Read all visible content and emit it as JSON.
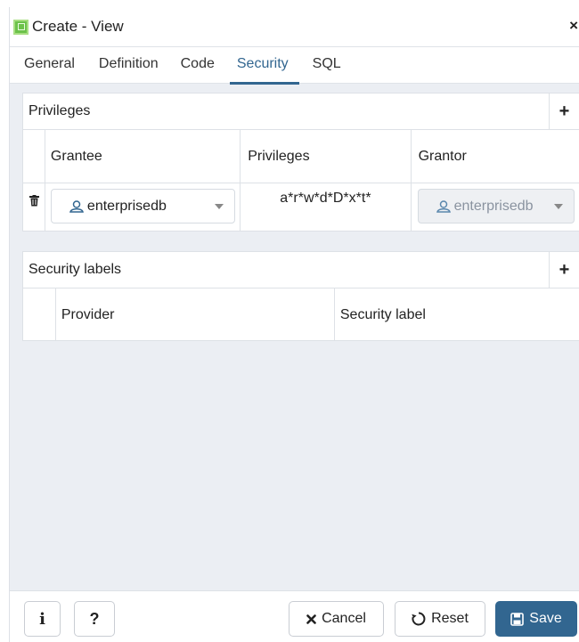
{
  "window": {
    "title": "Create - View",
    "close_symbol": "×"
  },
  "tabs": [
    {
      "label": "General",
      "active": false
    },
    {
      "label": "Definition",
      "active": false
    },
    {
      "label": "Code",
      "active": false
    },
    {
      "label": "Security",
      "active": true
    },
    {
      "label": "SQL",
      "active": false
    }
  ],
  "privileges": {
    "title": "Privileges",
    "add_symbol": "+",
    "columns": [
      "Grantee",
      "Privileges",
      "Grantor"
    ],
    "rows": [
      {
        "grantee": "enterprisedb",
        "privileges": "a*r*w*d*D*x*t*",
        "grantor": "enterprisedb"
      }
    ]
  },
  "security_labels": {
    "title": "Security labels",
    "add_symbol": "+",
    "columns": [
      "Provider",
      "Security label"
    ],
    "rows": []
  },
  "footer": {
    "info_symbol": "i",
    "help_symbol": "?",
    "cancel_label": "Cancel",
    "reset_label": "Reset",
    "save_label": "Save"
  },
  "colors": {
    "accent": "#326690",
    "border": "#dde1e6",
    "background": "#ebeef3"
  },
  "icons": [
    "app-icon",
    "close-icon",
    "add-icon",
    "delete-icon",
    "user-icon",
    "info-icon",
    "help-icon",
    "cancel-icon",
    "reset-icon",
    "save-icon"
  ]
}
